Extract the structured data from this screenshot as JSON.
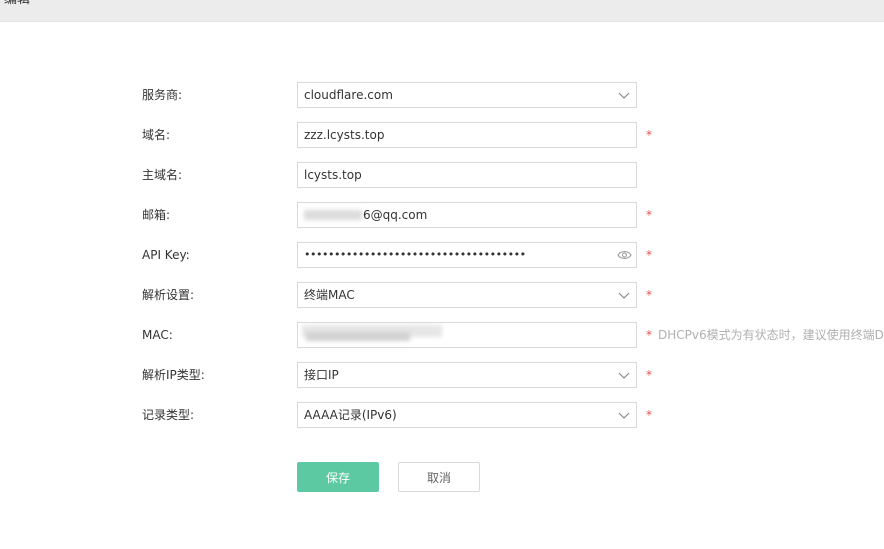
{
  "header": {
    "title": "编辑"
  },
  "form": {
    "provider": {
      "label": "服务商:",
      "value": "cloudflare.com"
    },
    "domain": {
      "label": "域名:",
      "value": "zzz.lcysts.top",
      "required": "*"
    },
    "main_domain": {
      "label": "主域名:",
      "value": "lcysts.top"
    },
    "email": {
      "label": "邮箱:",
      "value": "6@qq.com",
      "required": "*"
    },
    "api_key": {
      "label": "API Key:",
      "value": "•••••••••••••••••••••••••••••••••••••",
      "required": "*"
    },
    "resolve_setting": {
      "label": "解析设置:",
      "value": "终端MAC",
      "required": "*"
    },
    "mac": {
      "label": "MAC:",
      "value": "",
      "required": "*",
      "hint": "DHCPv6模式为有状态时，建议使用终端D"
    },
    "ip_type": {
      "label": "解析IP类型:",
      "value": "接口IP",
      "required": "*"
    },
    "record_type": {
      "label": "记录类型:",
      "value": "AAAA记录(IPv6)",
      "required": "*"
    }
  },
  "buttons": {
    "save": "保存",
    "cancel": "取消"
  },
  "colors": {
    "accent": "#5cc9a2",
    "required": "#f05050",
    "hint": "#b0b0b0"
  }
}
